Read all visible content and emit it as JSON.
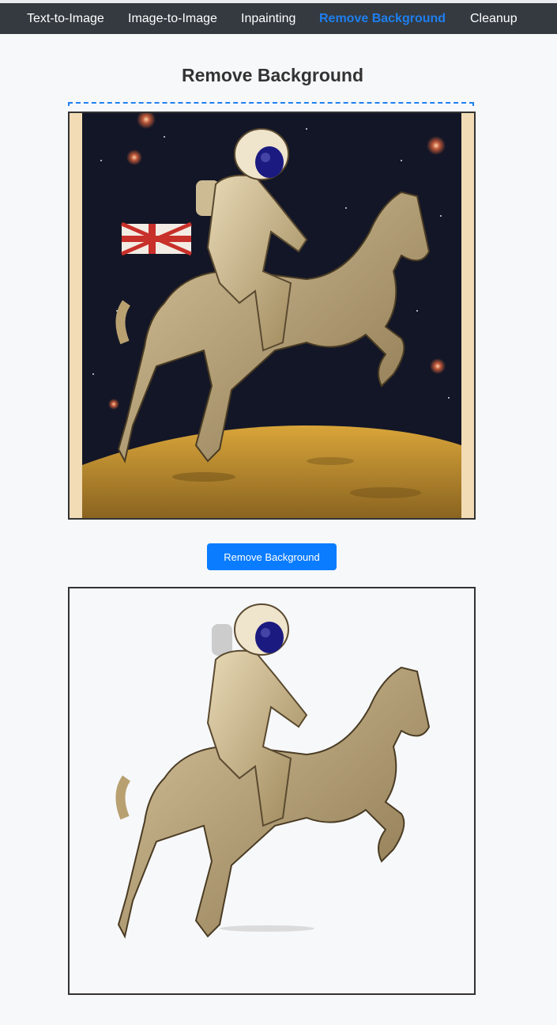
{
  "nav": {
    "items": [
      {
        "label": "Text-to-Image",
        "active": false
      },
      {
        "label": "Image-to-Image",
        "active": false
      },
      {
        "label": "Inpainting",
        "active": false
      },
      {
        "label": "Remove Background",
        "active": true
      },
      {
        "label": "Cleanup",
        "active": false
      }
    ],
    "active_color": "#1e7ff0",
    "background_color": "#343a40"
  },
  "page": {
    "title": "Remove Background"
  },
  "input_image": {
    "subject": "astronaut riding a horse on the moon with a flag and starry sky"
  },
  "action": {
    "label": "Remove Background",
    "color": "#0a7cff"
  },
  "output_image": {
    "subject": "astronaut riding a horse with background removed"
  }
}
